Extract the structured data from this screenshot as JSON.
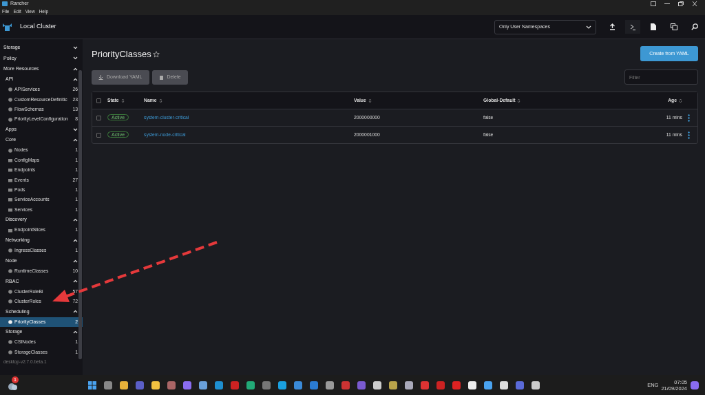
{
  "window": {
    "title": "Rancher"
  },
  "menu": [
    "File",
    "Edit",
    "View",
    "Help"
  ],
  "header": {
    "cluster": "Local Cluster",
    "namespace_filter": "Only User Namespaces"
  },
  "sidebar": {
    "groups": [
      {
        "label": "Storage",
        "expanded": false
      },
      {
        "label": "Policy",
        "expanded": false
      },
      {
        "label": "More Resources",
        "expanded": true,
        "children": [
          {
            "label": "API",
            "expanded": true,
            "children": [
              {
                "label": "APIServices",
                "count": "26",
                "kind": "circle",
                "selected": false
              },
              {
                "label": "CustomResourceDefinitic",
                "count": "23",
                "kind": "circle",
                "selected": false
              },
              {
                "label": "FlowSchemas",
                "count": "13",
                "kind": "circle",
                "selected": false
              },
              {
                "label": "PriorityLevelConfiguration",
                "count": "8",
                "kind": "circle",
                "selected": false
              }
            ]
          },
          {
            "label": "Apps",
            "expanded": false
          },
          {
            "label": "Core",
            "expanded": true,
            "children": [
              {
                "label": "Nodes",
                "count": "1",
                "kind": "circle",
                "selected": false
              },
              {
                "label": "ConfigMaps",
                "count": "1",
                "kind": "folder",
                "selected": false
              },
              {
                "label": "Endpoints",
                "count": "1",
                "kind": "folder",
                "selected": false
              },
              {
                "label": "Events",
                "count": "27",
                "kind": "folder",
                "selected": false
              },
              {
                "label": "Pods",
                "count": "1",
                "kind": "folder",
                "selected": false
              },
              {
                "label": "ServiceAccounts",
                "count": "1",
                "kind": "folder",
                "selected": false
              },
              {
                "label": "Services",
                "count": "1",
                "kind": "folder",
                "selected": false
              }
            ]
          },
          {
            "label": "Discovery",
            "expanded": true,
            "children": [
              {
                "label": "EndpointSlices",
                "count": "1",
                "kind": "folder",
                "selected": false
              }
            ]
          },
          {
            "label": "Networking",
            "expanded": true,
            "children": [
              {
                "label": "IngressClasses",
                "count": "1",
                "kind": "circle",
                "selected": false
              }
            ]
          },
          {
            "label": "Node",
            "expanded": true,
            "children": [
              {
                "label": "RuntimeClasses",
                "count": "10",
                "kind": "circle",
                "selected": false
              }
            ]
          },
          {
            "label": "RBAC",
            "expanded": true,
            "children": [
              {
                "label": "ClusterRoleBi",
                "count": "57",
                "kind": "circle",
                "selected": false
              },
              {
                "label": "ClusterRoles",
                "count": "72",
                "kind": "circle",
                "selected": false
              }
            ]
          },
          {
            "label": "Scheduling",
            "expanded": true,
            "children": [
              {
                "label": "PriorityClasses",
                "count": "2",
                "kind": "circle",
                "selected": true
              }
            ]
          },
          {
            "label": "Storage",
            "expanded": true,
            "children": [
              {
                "label": "CSINodes",
                "count": "1",
                "kind": "circle",
                "selected": false
              },
              {
                "label": "StorageClasses",
                "count": "1",
                "kind": "circle",
                "selected": false
              }
            ]
          }
        ]
      }
    ],
    "version": "desktop-v2.7.0.beta.1"
  },
  "page": {
    "title": "PriorityClasses",
    "create_button": "Create from YAML",
    "actions": [
      {
        "label": "Download YAML",
        "kind": "download",
        "disabled": true
      },
      {
        "label": "Delete",
        "kind": "delete",
        "disabled": true
      }
    ],
    "filter": {
      "placeholder": "Filter"
    }
  },
  "table": {
    "select_all_checked": false,
    "columns": [
      "State",
      "Name",
      "Value",
      "Global-Default",
      "Age"
    ],
    "rows": [
      {
        "checked": false,
        "state": "Active",
        "name": "system-cluster-critical",
        "value": "2000000000",
        "global_default": "false",
        "age": "11 mins"
      },
      {
        "checked": false,
        "state": "Active",
        "name": "system-node-critical",
        "value": "2000001000",
        "global_default": "false",
        "age": "11 mins"
      }
    ]
  },
  "taskbar": {
    "weather_badge": "1",
    "language": "ENG",
    "time": "07:05",
    "date": "21/09/2024"
  }
}
